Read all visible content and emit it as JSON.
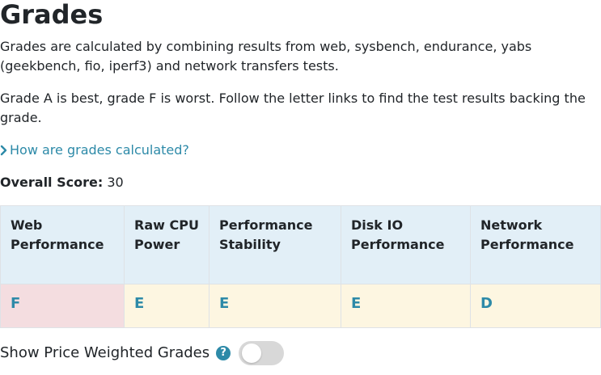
{
  "title": "Grades",
  "intro": "Grades are calculated by combining results from web, sysbench, endurance, yabs (geekbench, fio, iperf3) and network transfers tests.",
  "explain": "Grade A is best, grade F is worst. Follow the letter links to find the test results backing the grade.",
  "calc_link": "How are grades calculated?",
  "overall": {
    "label": "Overall Score:",
    "value": "30"
  },
  "table": {
    "headers": [
      "Web Performance",
      "Raw CPU Power",
      "Performance Stability",
      "Disk IO Performance",
      "Network Performance"
    ],
    "grades": [
      "F",
      "E",
      "E",
      "E",
      "D"
    ]
  },
  "price_toggle": {
    "label": "Show Price Weighted Grades",
    "help": "?",
    "on": false
  },
  "colors": {
    "link": "#2d8aa8",
    "header_bg": "#e2eff7",
    "grade_F_bg": "#f4dde0",
    "grade_E_bg": "#fdf6e1"
  },
  "icons": {
    "calc_link": "chevron-right-icon",
    "help": "question-circle-icon"
  }
}
